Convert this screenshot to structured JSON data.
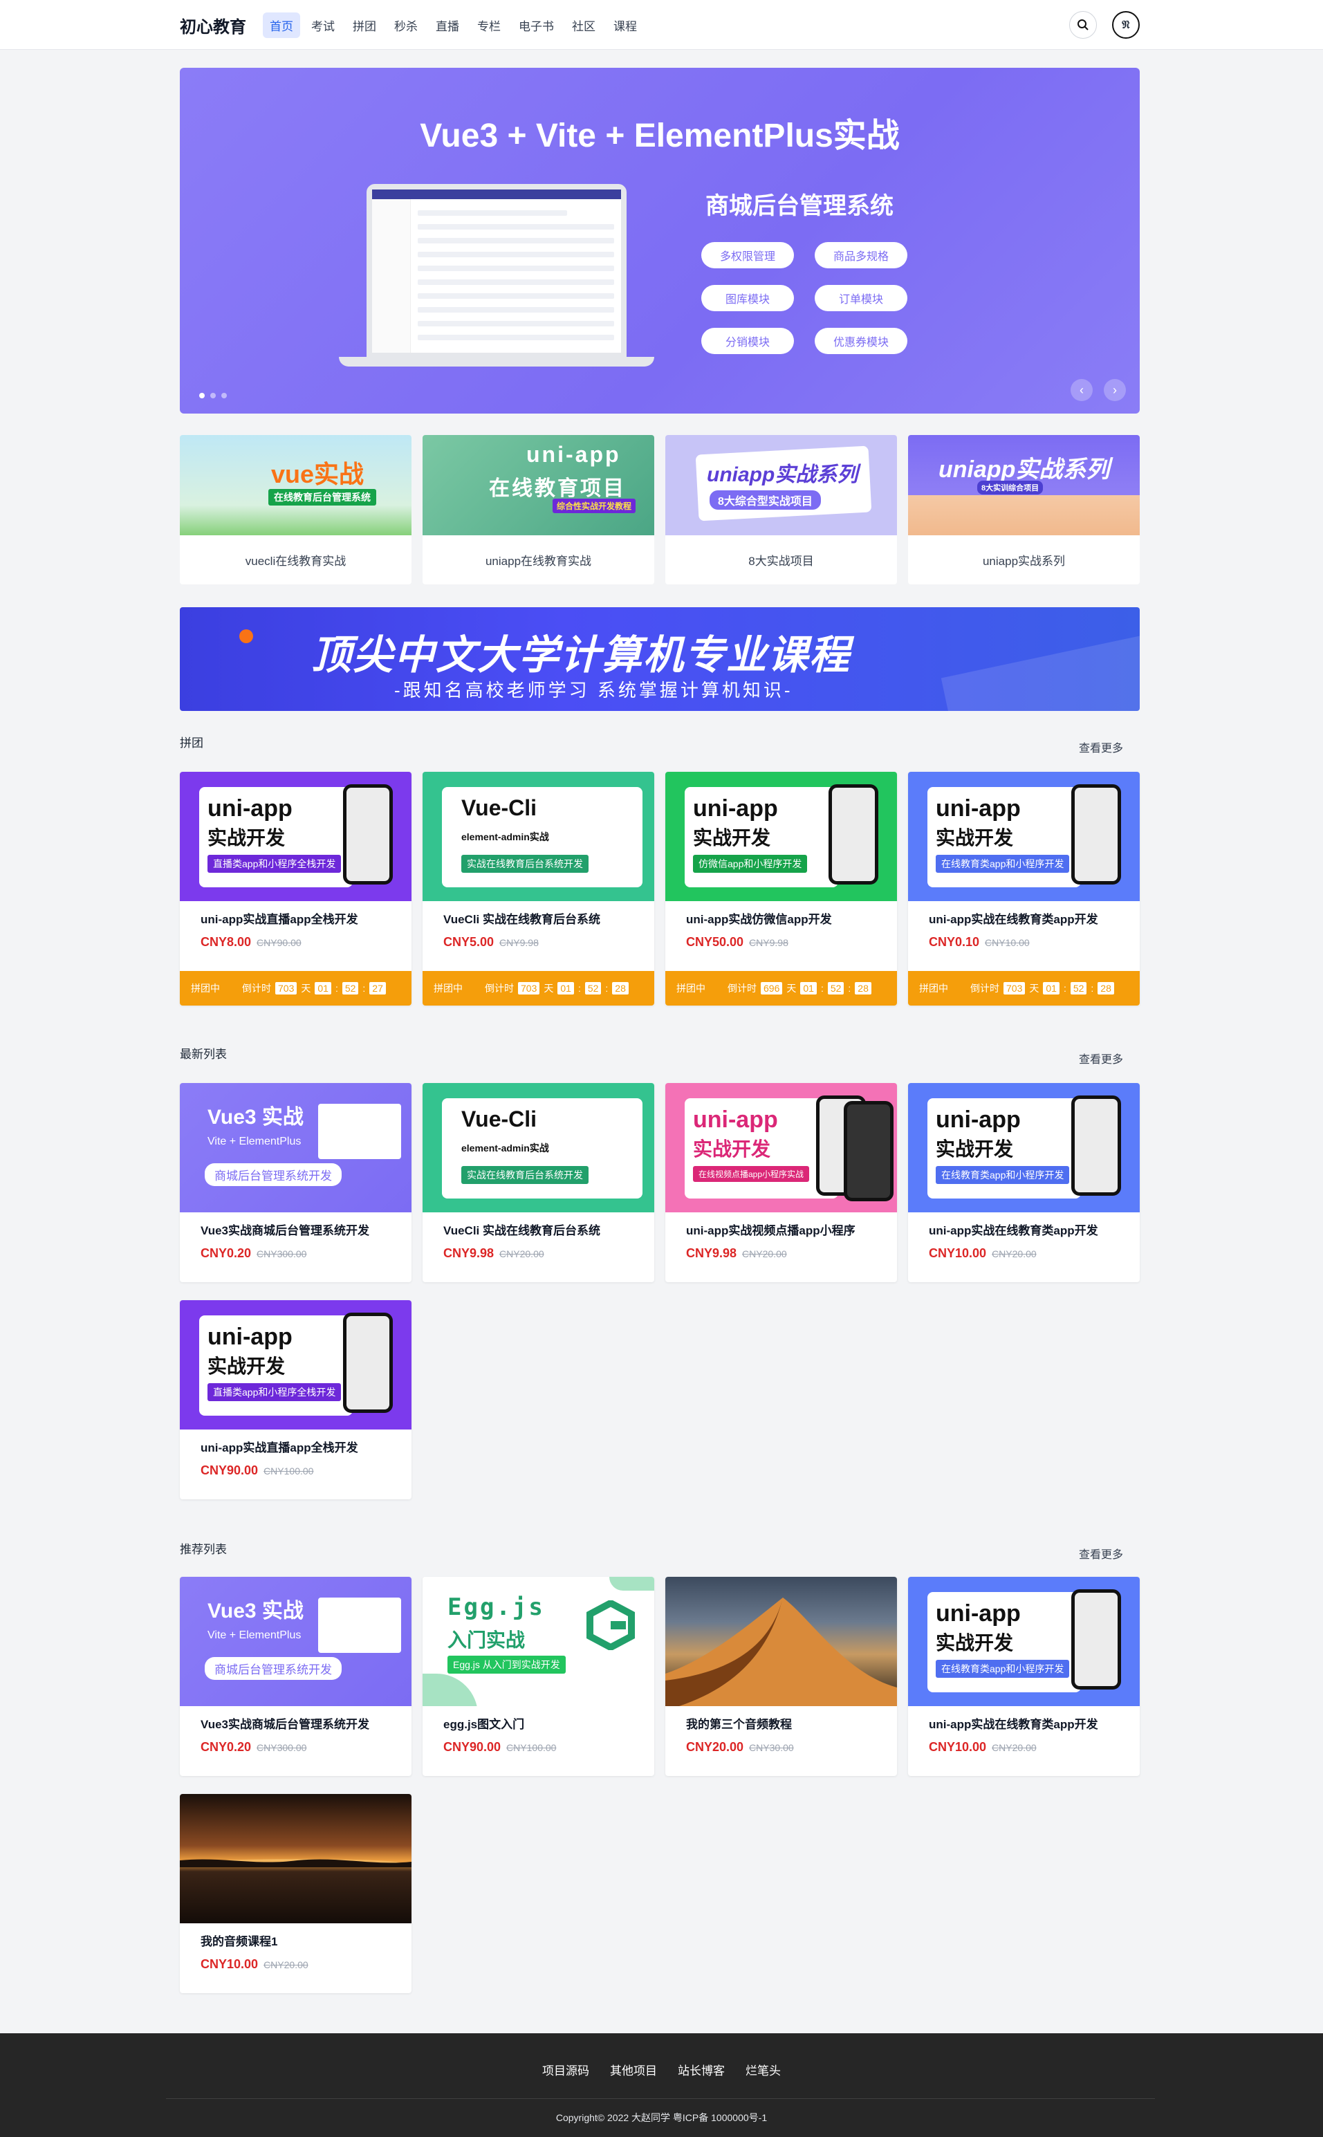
{
  "header": {
    "logo": "初心教育",
    "nav": [
      "首页",
      "考试",
      "拼团",
      "秒杀",
      "直播",
      "专栏",
      "电子书",
      "社区",
      "课程"
    ],
    "avatar_text": "𝔑"
  },
  "banner": {
    "title": "Vue3 + Vite + ElementPlus实战",
    "subtitle": "商城后台管理系统",
    "pills": [
      "多权限管理",
      "商品多规格",
      "图库模块",
      "订单模块",
      "分销模块",
      "优惠券模块"
    ],
    "accent": "#7c6cf3"
  },
  "categories": [
    {
      "label": "vuecli在线教育实战",
      "img_title": "vue实战",
      "img_sub": "在线教育后台管理系统"
    },
    {
      "label": "uniapp在线教育实战",
      "img_title": "uni-app",
      "img_sub": "在线教育项目",
      "img_tag": "综合性实战开发教程"
    },
    {
      "label": "8大实战项目",
      "img_title": "uniapp实战系列",
      "img_sub": "8大综合型实战项目"
    },
    {
      "label": "uniapp实战系列",
      "img_title": "uniapp实战系列",
      "img_sub": "8大实训综合项目"
    }
  ],
  "ad": {
    "title": "顶尖中文大学计算机专业课程",
    "sub": "-跟知名高校老师学习 系统掌握计算机知识-"
  },
  "sections": {
    "group": {
      "title": "拼团",
      "more": "查看更多"
    },
    "latest": {
      "title": "最新列表",
      "more": "查看更多"
    },
    "recommend": {
      "title": "推荐列表",
      "more": "查看更多"
    }
  },
  "group_cards": [
    {
      "title": "uni-app实战直播app全栈开发",
      "price": "CNY8.00",
      "oprice": "CNY90.00",
      "img1": "uni-app",
      "img2": "实战开发",
      "tag": "直播类app和小程序全栈开发",
      "bg": "#7c3aed",
      "status": "拼团中",
      "cd_label": "倒计时",
      "days": "703",
      "day_unit": "天",
      "h": "01",
      "m": "52",
      "s": "27"
    },
    {
      "title": "VueCli 实战在线教育后台系统",
      "price": "CNY5.00",
      "oprice": "CNY9.98",
      "img1": "Vue-Cli",
      "img2": "element-admin实战",
      "tag": "实战在线教育后台系统开发",
      "bg": "#34c38f",
      "status": "拼团中",
      "cd_label": "倒计时",
      "days": "703",
      "day_unit": "天",
      "h": "01",
      "m": "52",
      "s": "28"
    },
    {
      "title": "uni-app实战仿微信app开发",
      "price": "CNY50.00",
      "oprice": "CNY9.98",
      "img1": "uni-app",
      "img2": "实战开发",
      "tag": "仿微信app和小程序开发",
      "bg": "#22c55e",
      "status": "拼团中",
      "cd_label": "倒计时",
      "days": "696",
      "day_unit": "天",
      "h": "01",
      "m": "52",
      "s": "28"
    },
    {
      "title": "uni-app实战在线教育类app开发",
      "price": "CNY0.10",
      "oprice": "CNY10.00",
      "img1": "uni-app",
      "img2": "实战开发",
      "tag": "在线教育类app和小程序开发",
      "bg": "#5b7cfa",
      "status": "拼团中",
      "cd_label": "倒计时",
      "days": "703",
      "day_unit": "天",
      "h": "01",
      "m": "52",
      "s": "28"
    }
  ],
  "latest_cards": [
    {
      "title": "Vue3实战商城后台管理系统开发",
      "price": "CNY0.20",
      "oprice": "CNY300.00",
      "img1": "Vue3 实战",
      "img2": "Vite + ElementPlus",
      "tag": "商城后台管理系统开发",
      "bg": "#8b7cf7"
    },
    {
      "title": "VueCli 实战在线教育后台系统",
      "price": "CNY9.98",
      "oprice": "CNY20.00",
      "img1": "Vue-Cli",
      "img2": "element-admin实战",
      "tag": "实战在线教育后台系统开发",
      "bg": "#34c38f"
    },
    {
      "title": "uni-app实战视频点播app小程序",
      "price": "CNY9.98",
      "oprice": "CNY20.00",
      "img1": "uni-app",
      "img2": "实战开发",
      "tag": "在线视频点播app小程序实战",
      "bg": "#f472b6"
    },
    {
      "title": "uni-app实战在线教育类app开发",
      "price": "CNY10.00",
      "oprice": "CNY20.00",
      "img1": "uni-app",
      "img2": "实战开发",
      "tag": "在线教育类app和小程序开发",
      "bg": "#5b7cfa"
    },
    {
      "title": "uni-app实战直播app全栈开发",
      "price": "CNY90.00",
      "oprice": "CNY100.00",
      "img1": "uni-app",
      "img2": "实战开发",
      "tag": "直播类app和小程序全栈开发",
      "bg": "#7c3aed"
    }
  ],
  "recommend_cards": [
    {
      "title": "Vue3实战商城后台管理系统开发",
      "price": "CNY0.20",
      "oprice": "CNY300.00",
      "img1": "Vue3 实战",
      "img2": "Vite + ElementPlus",
      "tag": "商城后台管理系统开发",
      "bg": "#8b7cf7"
    },
    {
      "title": "egg.js图文入门",
      "price": "CNY90.00",
      "oprice": "CNY100.00",
      "img1": "Egg.js",
      "img2": "入门实战",
      "tag": "Egg.js 从入门到实战开发",
      "bg": "#ffffff"
    },
    {
      "title": "我的第三个音频教程",
      "price": "CNY20.00",
      "oprice": "CNY30.00",
      "bg": "#c2753a"
    },
    {
      "title": "uni-app实战在线教育类app开发",
      "price": "CNY10.00",
      "oprice": "CNY20.00",
      "img1": "uni-app",
      "img2": "实战开发",
      "tag": "在线教育类app和小程序开发",
      "bg": "#5b7cfa"
    },
    {
      "title": "我的音频课程1",
      "price": "CNY10.00",
      "oprice": "CNY20.00",
      "bg": "#3a2416"
    }
  ],
  "footer": {
    "links": [
      "项目源码",
      "其他项目",
      "站长博客",
      "烂笔头"
    ],
    "copyright": "Copyright© 2022 大赵同学 粤ICP备 1000000号-1"
  }
}
